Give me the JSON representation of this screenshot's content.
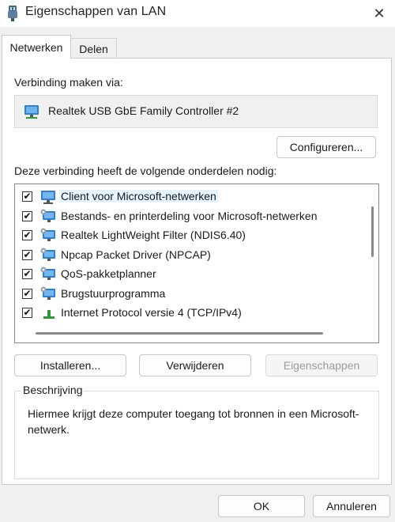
{
  "window": {
    "title": "Eigenschappen van LAN",
    "title_icon": "network-adapter-icon",
    "close_glyph": "✕"
  },
  "tabs": [
    {
      "label": "Netwerken",
      "active": true
    },
    {
      "label": "Delen",
      "active": false
    }
  ],
  "connection": {
    "label": "Verbinding maken via:",
    "adapter_name": "Realtek USB GbE Family Controller #2",
    "adapter_icon": "network-adapter-icon",
    "configure_button": "Configureren..."
  },
  "components": {
    "label": "Deze verbinding heeft de volgende onderdelen nodig:",
    "items": [
      {
        "label": "Client voor Microsoft-netwerken",
        "checked": true,
        "icon": "network-client-icon",
        "selected": true
      },
      {
        "label": "Bestands- en printerdeling voor Microsoft-netwerken",
        "checked": true,
        "icon": "network-service-icon",
        "selected": false
      },
      {
        "label": "Realtek LightWeight Filter (NDIS6.40)",
        "checked": true,
        "icon": "network-service-icon",
        "selected": false
      },
      {
        "label": "Npcap Packet Driver (NPCAP)",
        "checked": true,
        "icon": "network-service-icon",
        "selected": false
      },
      {
        "label": "QoS-pakketplanner",
        "checked": true,
        "icon": "network-service-icon",
        "selected": false
      },
      {
        "label": "Brugstuurprogramma",
        "checked": true,
        "icon": "network-service-icon",
        "selected": false
      },
      {
        "label": "Internet Protocol versie 4 (TCP/IPv4)",
        "checked": true,
        "icon": "network-protocol-icon",
        "selected": false
      }
    ],
    "check_glyph": "✔"
  },
  "actions": {
    "install": "Installeren...",
    "remove": "Verwijderen",
    "properties": "Eigenschappen"
  },
  "description": {
    "legend": "Beschrijving",
    "text": "Hiermee krijgt deze computer toegang tot bronnen in een Microsoft-netwerk."
  },
  "footer": {
    "ok": "OK",
    "cancel": "Annuleren"
  },
  "colors": {
    "selected_row": "#e5f3ff",
    "monitor_blue": "#2f7fd0",
    "protocol_green": "#2f9a3a"
  }
}
